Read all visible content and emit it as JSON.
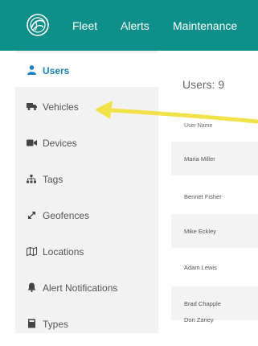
{
  "header": {
    "nav": [
      {
        "label": "Fleet"
      },
      {
        "label": "Alerts"
      },
      {
        "label": "Maintenance"
      }
    ]
  },
  "sidebar": {
    "items": [
      {
        "label": "Users",
        "icon": "user-icon",
        "active": true
      },
      {
        "label": "Vehicles",
        "icon": "truck-icon"
      },
      {
        "label": "Devices",
        "icon": "video-camera-icon"
      },
      {
        "label": "Tags",
        "icon": "sitemap-icon"
      },
      {
        "label": "Geofences",
        "icon": "expand-icon"
      },
      {
        "label": "Locations",
        "icon": "map-icon"
      },
      {
        "label": "Alert Notifications",
        "icon": "bell-icon"
      },
      {
        "label": "Types",
        "icon": "book-icon"
      }
    ]
  },
  "main": {
    "title": "Users: 9",
    "table": {
      "column_header": "User Name",
      "rows": [
        "Maria Miller",
        "Bennet Fisher",
        "Mike Eckley",
        "Adam Lewis",
        "Brad Chapple",
        "Don Zaney"
      ]
    }
  },
  "colors": {
    "topbar": "#0f8f8a",
    "accent": "#1a7fc0",
    "sidebar_bg": "#f2f2f2",
    "annotation_arrow": "#f2e24a"
  }
}
